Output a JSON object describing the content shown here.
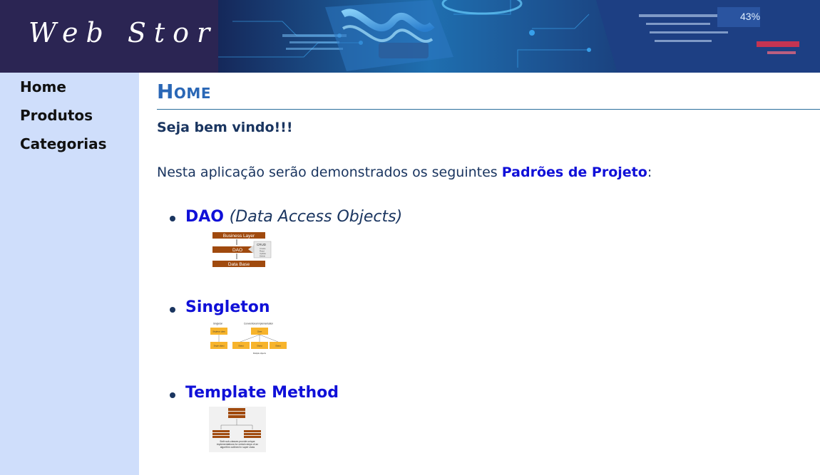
{
  "header": {
    "logo_text": "Web Store",
    "banner_percent": "43%"
  },
  "sidebar": {
    "items": [
      {
        "label": "Home"
      },
      {
        "label": "Produtos"
      },
      {
        "label": "Categorias"
      }
    ]
  },
  "main": {
    "title": "Home",
    "welcome": "Seja bem vindo!!!",
    "intro_prefix": "Nesta aplicação serão demonstrados os seguintes ",
    "intro_link": "Padrões de Projeto",
    "intro_suffix": ":",
    "patterns": [
      {
        "name": "DAO",
        "subtitle": "(Data Access Objects)",
        "diagram": {
          "business_layer": "Business Layer",
          "dao": "DAO",
          "data_base": "Data Base",
          "crud_title": "CRUD",
          "crud_items": [
            "Create",
            "Read",
            "Update",
            "Delete"
          ]
        }
      },
      {
        "name": "Singleton",
        "diagram": {
          "left_title": "Singleton",
          "right_title": "Conventional implementation",
          "left_top": "Singleton class",
          "left_bottom": "Single object",
          "right_top": "Class",
          "right_objects": [
            "Object",
            "Object",
            "Object"
          ],
          "caption": "Multiple objects"
        }
      },
      {
        "name": "Template Method",
        "diagram": {
          "caption": "Both sub-classes provide unique implementations for certain steps of an algorithm outlined in super class"
        }
      }
    ]
  },
  "colors": {
    "header_bg": "#2b2553",
    "sidebar_bg": "#cfdefb",
    "title": "#2a67b6",
    "link": "#1010d8",
    "text": "#1a3560",
    "diagram_brown": "#a04a0e",
    "diagram_orange": "#f7b42c"
  }
}
